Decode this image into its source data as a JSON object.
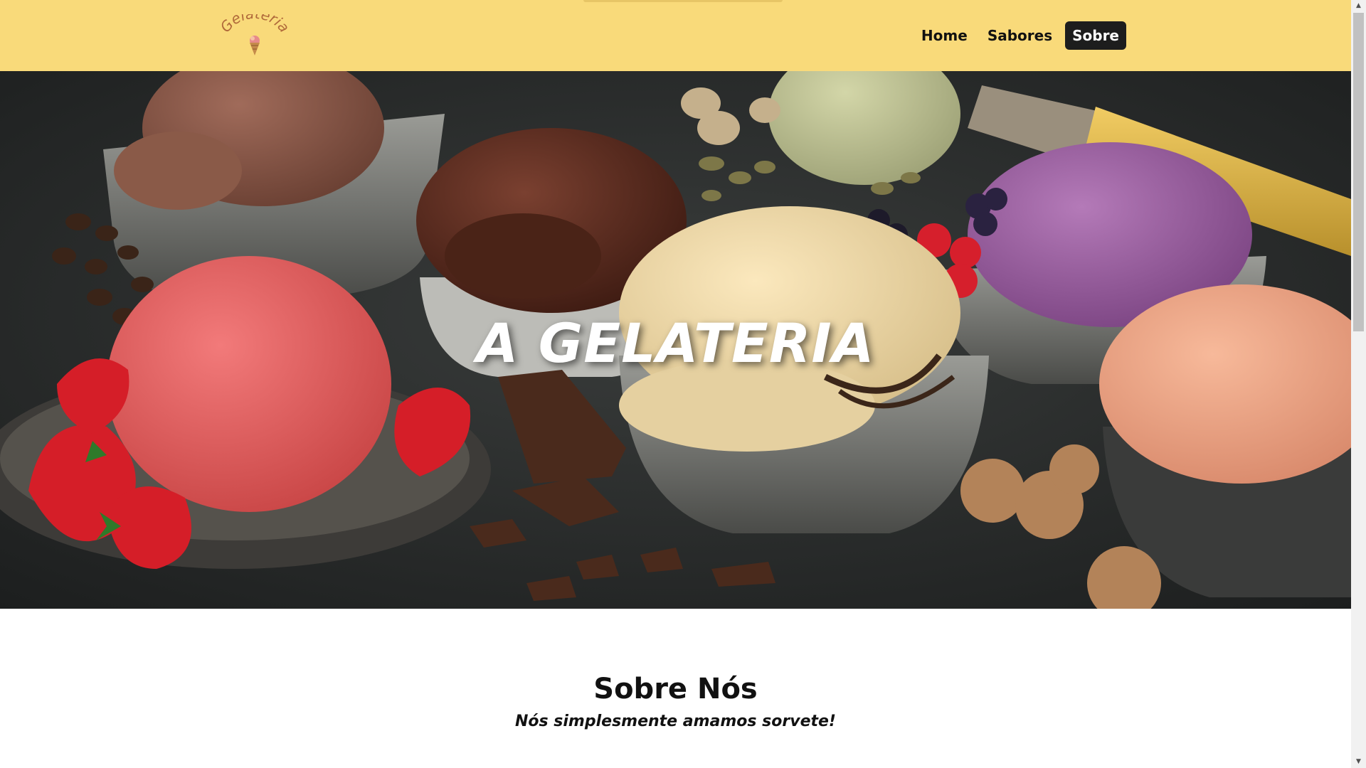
{
  "logo": {
    "text": "Gelateria"
  },
  "nav": {
    "home": "Home",
    "sabores": "Sabores",
    "sobre": "Sobre"
  },
  "hero": {
    "title": "A GELATERIA"
  },
  "about": {
    "title": "Sobre Nós",
    "subtitle": "Nós simplesmente amamos sorvete!"
  },
  "colors": {
    "header_bg": "#f9da7a",
    "active_nav_bg": "#1d1d1d"
  }
}
